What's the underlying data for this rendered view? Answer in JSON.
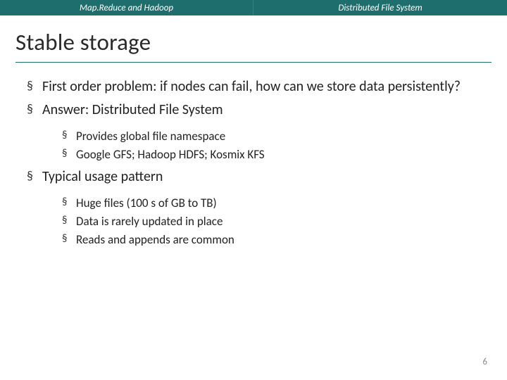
{
  "header": {
    "left": "Map.Reduce and Hadoop",
    "right": "Distributed File System"
  },
  "title": "Stable storage",
  "bullets": [
    {
      "text": "First order problem: if nodes can fail, how can we store data persistently?",
      "children": []
    },
    {
      "text": "Answer: Distributed File System",
      "children": [
        "Provides global file namespace",
        "Google GFS; Hadoop HDFS; Kosmix KFS"
      ]
    },
    {
      "text": "Typical usage pattern",
      "children": [
        "Huge files (100 s of GB to TB)",
        "Data is rarely updated in place",
        "Reads and appends are common"
      ]
    }
  ],
  "page_number": "6"
}
